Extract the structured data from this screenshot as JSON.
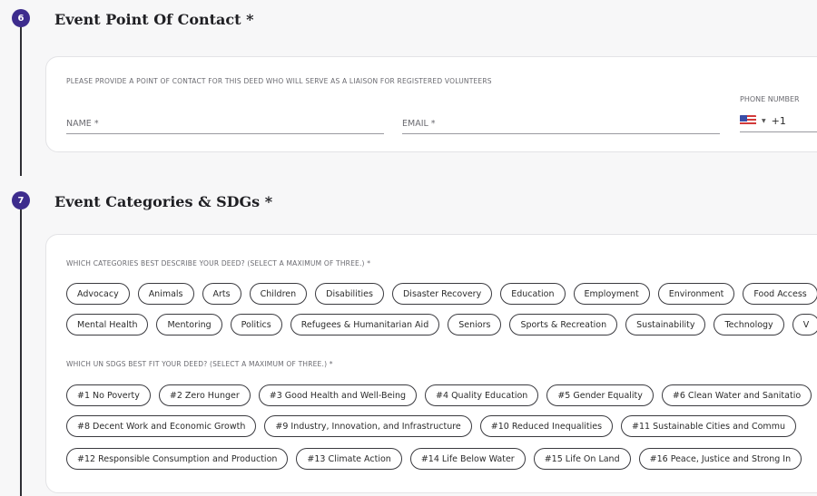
{
  "contact_section": {
    "step": "6",
    "title": "Event Point Of Contact *",
    "instruction": "PLEASE PROVIDE A POINT OF CONTACT FOR THIS DEED WHO WILL SERVE AS A LIAISON FOR REGISTERED VOLUNTEERS",
    "name_placeholder": "NAME *",
    "email_placeholder": "EMAIL *",
    "phone_label": "PHONE NUMBER",
    "phone_country_code": "+1",
    "colors": {
      "badge": "#3d2c8d"
    }
  },
  "categories_section": {
    "step": "7",
    "title": "Event Categories & SDGs *",
    "categories_question": "WHICH CATEGORIES BEST DESCRIBE YOUR DEED? (SELECT A MAXIMUM OF THREE.) *",
    "categories_row1": [
      "Advocacy",
      "Animals",
      "Arts",
      "Children",
      "Disabilities",
      "Disaster Recovery",
      "Education",
      "Employment",
      "Environment",
      "Food Access"
    ],
    "categories_row2": [
      "Mental Health",
      "Mentoring",
      "Politics",
      "Refugees & Humanitarian Aid",
      "Seniors",
      "Sports & Recreation",
      "Sustainability",
      "Technology",
      "V"
    ],
    "sdgs_question": "WHICH UN SDGS BEST FIT YOUR DEED? (SELECT A MAXIMUM OF THREE.) *",
    "sdgs_row1": [
      "#1 No Poverty",
      "#2 Zero Hunger",
      "#3 Good Health and Well-Being",
      "#4 Quality Education",
      "#5 Gender Equality",
      "#6 Clean Water and Sanitatio"
    ],
    "sdgs_row2": [
      "#8 Decent Work and Economic Growth",
      "#9 Industry, Innovation, and Infrastructure",
      "#10 Reduced Inequalities",
      "#11 Sustainable Cities and Commu"
    ],
    "sdgs_row3": [
      "#12 Responsible Consumption and Production",
      "#13 Climate Action",
      "#14 Life Below Water",
      "#15 Life On Land",
      "#16 Peace, Justice and Strong In"
    ]
  }
}
